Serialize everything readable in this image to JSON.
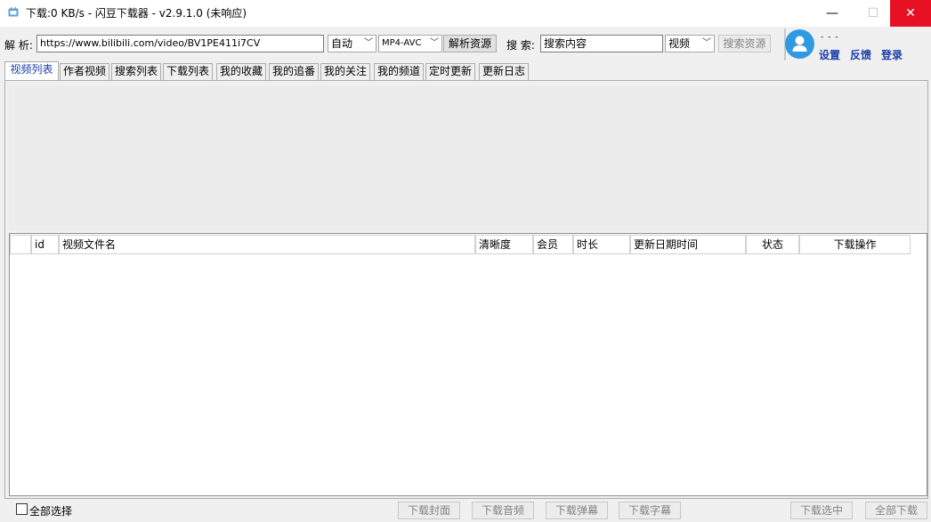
{
  "window": {
    "title": "下载:0 KB/s - 闪豆下载器 - v2.9.1.0 (未响应)",
    "controls": {
      "minimize": "—",
      "maximize": "☐",
      "close": "✕"
    }
  },
  "parse": {
    "label": "解 析:",
    "url_value": "https://www.bilibili.com/video/BV1PE411i7CV",
    "quality": "自动",
    "format": "MP4-AVC",
    "parse_button": "解析资源"
  },
  "search": {
    "label": "搜 索:",
    "value": "搜索内容",
    "type": "视频",
    "search_button": "搜索资源"
  },
  "user": {
    "status_dots": "- - -",
    "settings": "设置",
    "feedback": "反馈",
    "login": "登录"
  },
  "tabs": [
    "视频列表",
    "作者视频",
    "搜索列表",
    "下载列表",
    "我的收藏",
    "我的追番",
    "我的关注",
    "我的频道",
    "定时更新",
    "更新日志"
  ],
  "grid": {
    "columns": [
      "",
      "id",
      "视频文件名",
      "清晰度",
      "会员",
      "时长",
      "更新日期时间",
      "状态",
      "下载操作"
    ],
    "rows": []
  },
  "bottom": {
    "select_all": "全部选择",
    "download_cover": "下载封面",
    "download_audio": "下载音频",
    "download_danmaku": "下载弹幕",
    "download_subtitle": "下载字幕",
    "download_selected": "下载选中",
    "download_all": "全部下载"
  },
  "colors": {
    "accent": "#1c3ea9",
    "avatar": "#2f9ae0",
    "close_button": "#e81123"
  }
}
